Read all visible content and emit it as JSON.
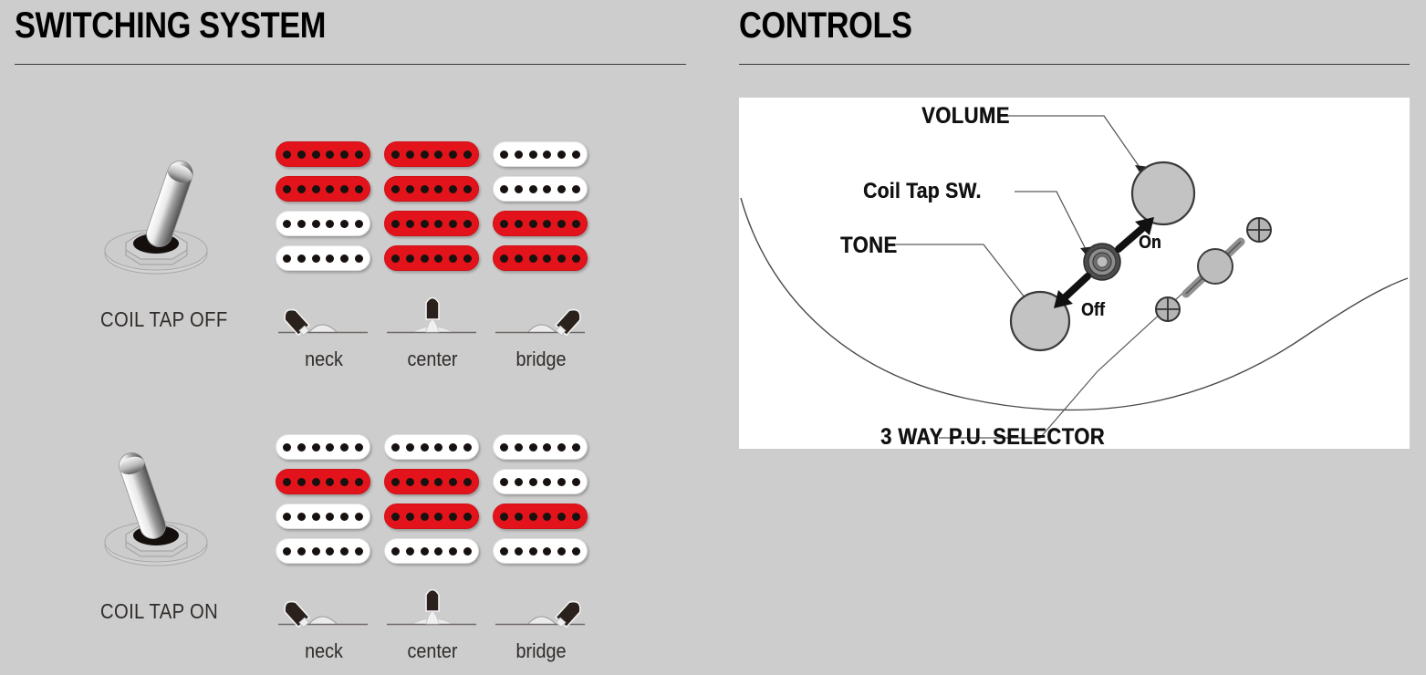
{
  "page": {
    "background_color": "#cdcdcd",
    "board_color": "#ffffff",
    "accent_red": "#e3131b",
    "text_color": "#2f2b29"
  },
  "switching_system": {
    "title": "SWITCHING SYSTEM",
    "rows": [
      {
        "toggle_label": "COIL TAP OFF",
        "toggle_lever_direction": "right",
        "positions": [
          {
            "name": "neck",
            "caption": "neck",
            "selector_direction": "left",
            "pickups": [
              {
                "top": "red",
                "bottom": "red"
              },
              {
                "top": "white",
                "bottom": "white"
              }
            ]
          },
          {
            "name": "center",
            "caption": "center",
            "selector_direction": "up",
            "pickups": [
              {
                "top": "red",
                "bottom": "red"
              },
              {
                "top": "red",
                "bottom": "red"
              }
            ]
          },
          {
            "name": "bridge",
            "caption": "bridge",
            "selector_direction": "right",
            "pickups": [
              {
                "top": "white",
                "bottom": "white"
              },
              {
                "top": "red",
                "bottom": "red"
              }
            ]
          }
        ]
      },
      {
        "toggle_label": "COIL TAP ON",
        "toggle_lever_direction": "left",
        "positions": [
          {
            "name": "neck",
            "caption": "neck",
            "selector_direction": "left",
            "pickups": [
              {
                "top": "white",
                "bottom": "red"
              },
              {
                "top": "white",
                "bottom": "white"
              }
            ]
          },
          {
            "name": "center",
            "caption": "center",
            "selector_direction": "up",
            "pickups": [
              {
                "top": "white",
                "bottom": "red"
              },
              {
                "top": "red",
                "bottom": "white"
              }
            ]
          },
          {
            "name": "bridge",
            "caption": "bridge",
            "selector_direction": "right",
            "pickups": [
              {
                "top": "white",
                "bottom": "white"
              },
              {
                "top": "red",
                "bottom": "white"
              }
            ]
          }
        ]
      }
    ],
    "poles_per_coil": 6
  },
  "controls": {
    "title": "CONTROLS",
    "labels": {
      "volume": "VOLUME",
      "coil_tap_sw": "Coil Tap SW.",
      "tone": "TONE",
      "on": "On",
      "off": "Off",
      "pu_selector": "3 WAY P.U. SELECTOR"
    },
    "parts": [
      {
        "name": "volume-knob",
        "shape": "circle",
        "fill": "#c3c3c3"
      },
      {
        "name": "tone-knob",
        "shape": "circle",
        "fill": "#c3c3c3"
      },
      {
        "name": "coil-tap-switch",
        "shape": "concentric",
        "fill": "#8a8a8a"
      },
      {
        "name": "three-way-selector",
        "shape": "lever",
        "fill": "#bdbdbd"
      },
      {
        "name": "mounting-screw",
        "shape": "cross-circle",
        "fill": "#b4b4b4"
      }
    ]
  }
}
